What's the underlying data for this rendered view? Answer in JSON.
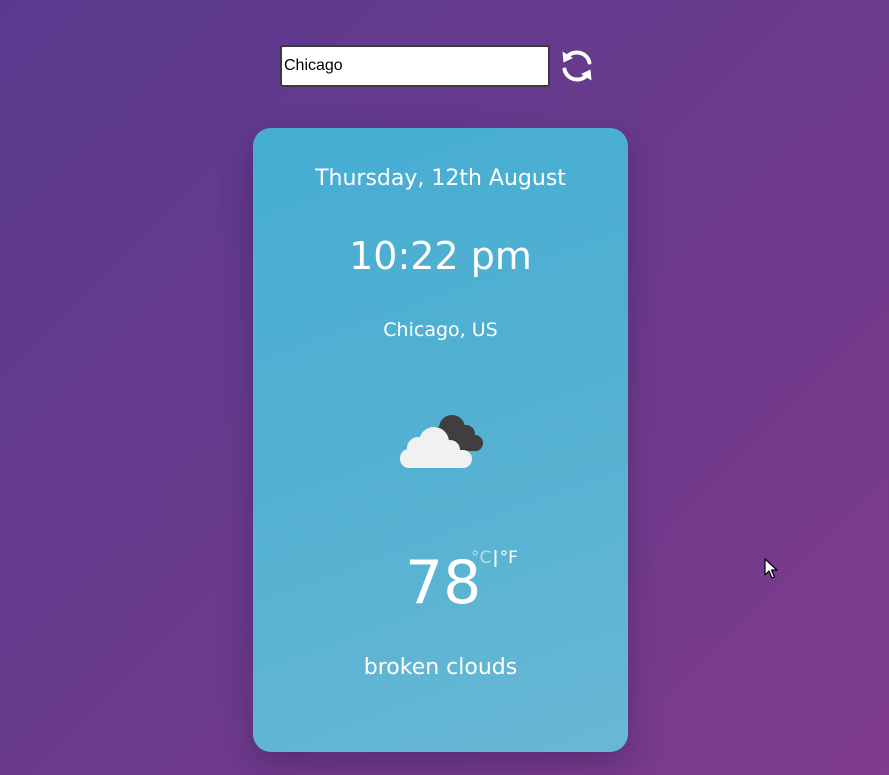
{
  "search": {
    "value": "Chicago"
  },
  "refresh": {
    "icon": "refresh-icon"
  },
  "weather": {
    "date": "Thursday, 12th August",
    "time": "10:22 pm",
    "location": "Chicago, US",
    "icon": "broken-clouds-icon",
    "temperature": "78",
    "unit_celsius": "°C",
    "unit_separator": "|",
    "unit_fahrenheit": "°F",
    "active_unit": "F",
    "description": "broken clouds"
  },
  "colors": {
    "background_start": "#5a3a8f",
    "background_end": "#7f3b8d",
    "card_start": "#46aed3",
    "card_end": "#68b8d4",
    "text": "#ffffff"
  }
}
